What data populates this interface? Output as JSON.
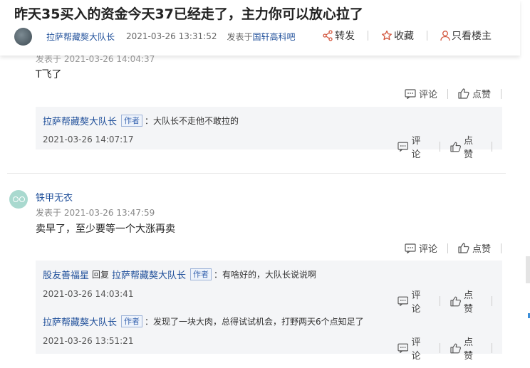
{
  "header": {
    "title": "昨天35买入的资金今天37已经走了，主力你可以放心拉了",
    "author": "拉萨帮藏獒大队长",
    "time": "2021-03-26 13:31:52",
    "posted_in_label": "发表于",
    "forum": "国轩高科吧",
    "actions": {
      "share": "转发",
      "favorite": "收藏",
      "only_author": "只看楼主"
    }
  },
  "reply1": {
    "partial_time": "发表于 2021-03-26 14:04:37",
    "text": "T飞了",
    "comment_label": "评论",
    "like_label": "点赞",
    "subs": [
      {
        "name": "拉萨帮藏獒大队长",
        "tag": "作者",
        "text": "：大队长不走他不敢拉的",
        "time": "2021-03-26 14:07:17",
        "comment_label": "评论",
        "like_label": "点赞"
      }
    ]
  },
  "reply2": {
    "name": "铁甲无衣",
    "time": "发表于 2021-03-26 13:47:59",
    "text": "卖早了，至少要等一个大涨再卖",
    "comment_label": "评论",
    "like_label": "点赞",
    "subs": [
      {
        "name": "股友善福星",
        "reply_word": "回复",
        "target": "拉萨帮藏獒大队长",
        "tag": "作者",
        "text": "：有啥好的，大队长说说啊",
        "time": "2021-03-26 14:03:41",
        "comment_label": "评论",
        "like_label": "点赞"
      },
      {
        "name": "拉萨帮藏獒大队长",
        "tag": "作者",
        "text": "：发现了一块大肉，总得试试机会，打野两天6个点知足了",
        "time": "2021-03-26 13:51:21",
        "comment_label": "评论",
        "like_label": "点赞"
      }
    ]
  }
}
